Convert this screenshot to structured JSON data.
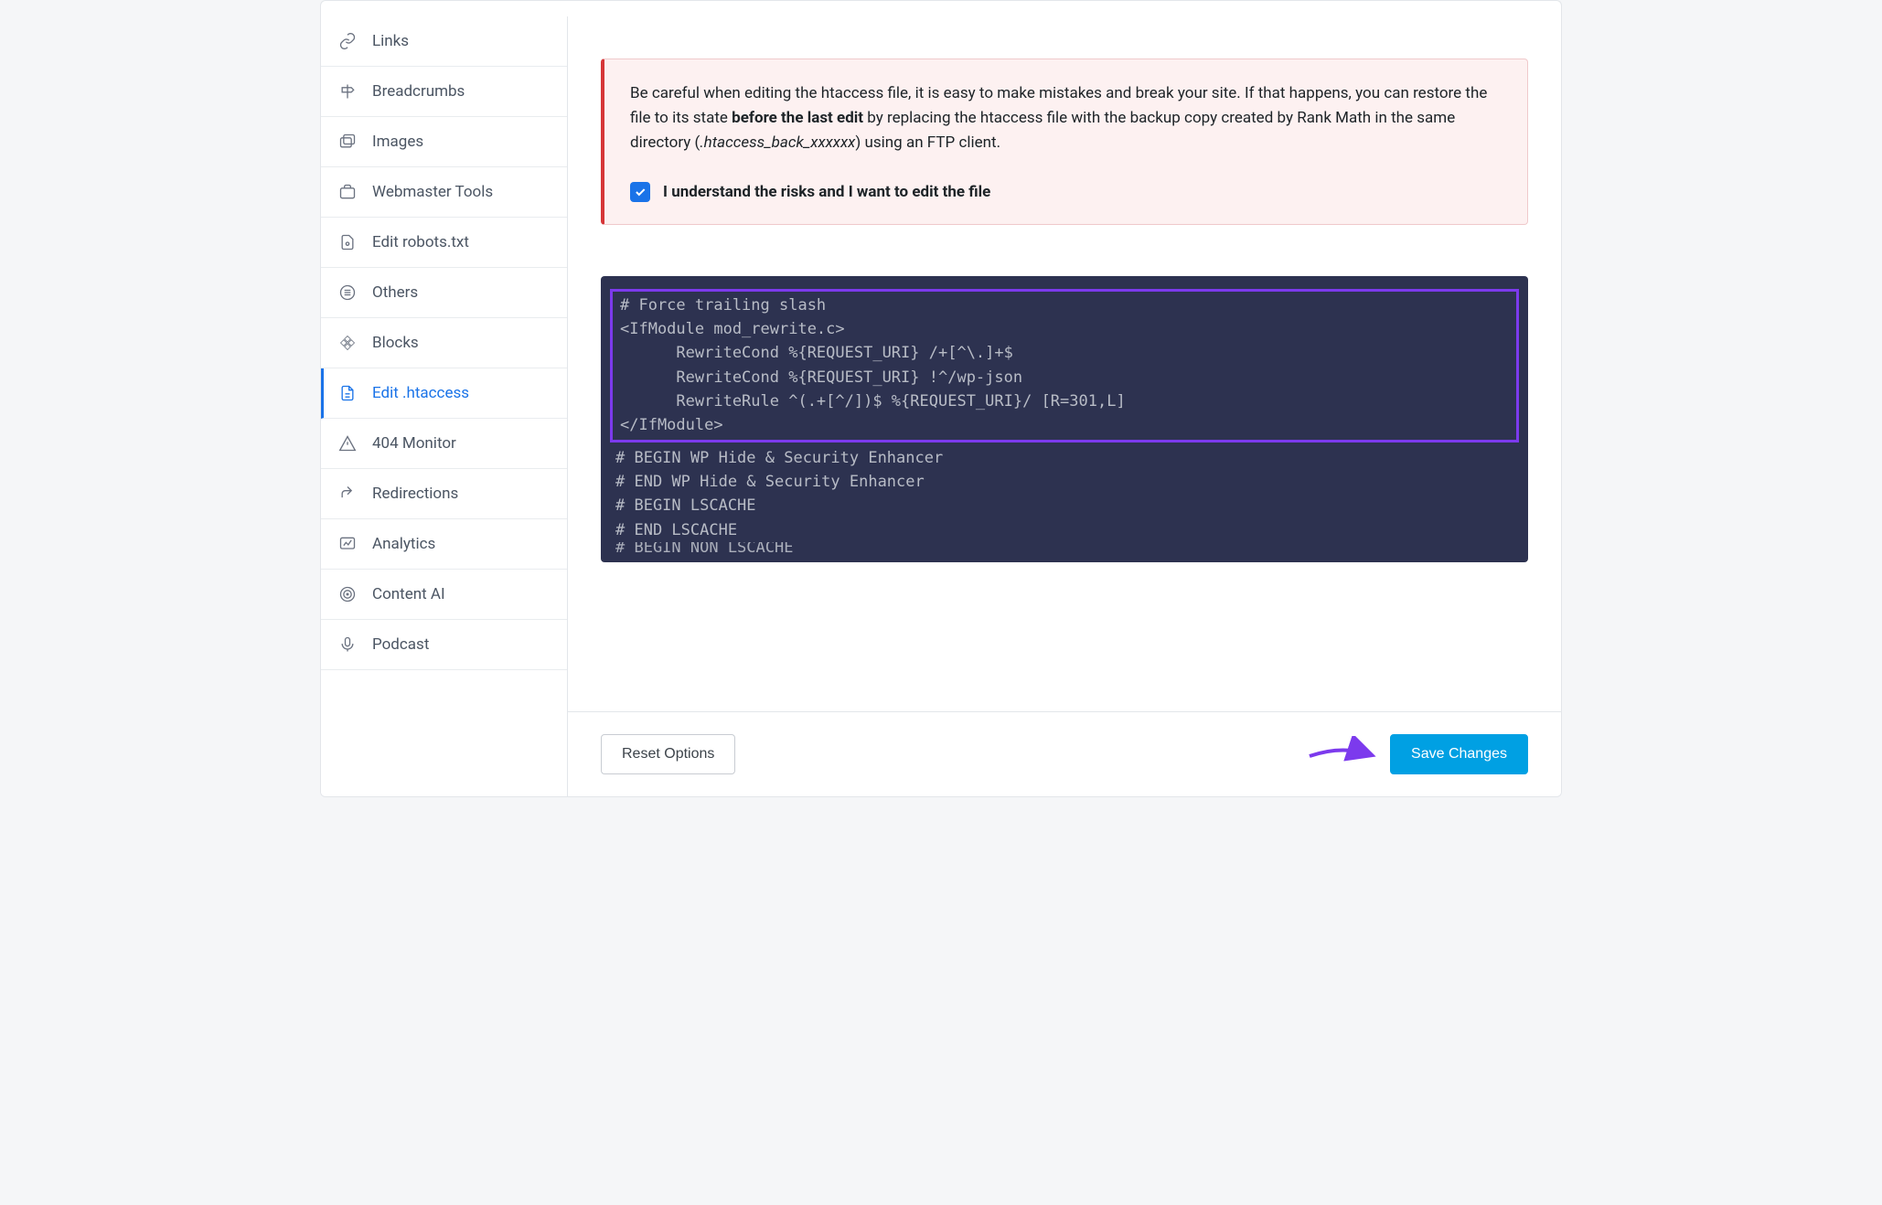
{
  "sidebar": {
    "items": [
      {
        "label": "Links",
        "icon": "link"
      },
      {
        "label": "Breadcrumbs",
        "icon": "signpost"
      },
      {
        "label": "Images",
        "icon": "images"
      },
      {
        "label": "Webmaster Tools",
        "icon": "briefcase"
      },
      {
        "label": "Edit robots.txt",
        "icon": "file-robot"
      },
      {
        "label": "Others",
        "icon": "list"
      },
      {
        "label": "Blocks",
        "icon": "diamond-grid"
      },
      {
        "label": "Edit .htaccess",
        "icon": "file-lines",
        "active": true
      },
      {
        "label": "404 Monitor",
        "icon": "alert"
      },
      {
        "label": "Redirections",
        "icon": "redirect"
      },
      {
        "label": "Analytics",
        "icon": "chart"
      },
      {
        "label": "Content AI",
        "icon": "target"
      },
      {
        "label": "Podcast",
        "icon": "mic"
      }
    ]
  },
  "warning": {
    "text_before_bold": "Be careful when editing the htaccess file, it is easy to make mistakes and break your site. If that happens, you can restore the file to its state ",
    "bold": "before the last edit",
    "text_after_bold_before_italic": " by replacing the htaccess file with the backup copy created by Rank Math in the same directory (",
    "italic": ".htaccess_back_xxxxxx",
    "text_after_italic": ") using an FTP client.",
    "consent_label": "I understand the risks and I want to edit the file",
    "consent_checked": true
  },
  "editor": {
    "highlighted_lines": [
      "# Force trailing slash",
      "<IfModule mod_rewrite.c>",
      "      RewriteCond %{REQUEST_URI} /+[^\\.]+$",
      "      RewriteCond %{REQUEST_URI} !^/wp-json",
      "      RewriteRule ^(.+[^/])$ %{REQUEST_URI}/ [R=301,L]",
      "</IfModule>"
    ],
    "plain_lines": [
      "# BEGIN WP Hide & Security Enhancer",
      "# END WP Hide & Security Enhancer",
      "# BEGIN LSCACHE",
      "# END LSCACHE",
      "# BEGIN NON_LSCACHE"
    ]
  },
  "footer": {
    "reset_label": "Reset Options",
    "save_label": "Save Changes"
  }
}
